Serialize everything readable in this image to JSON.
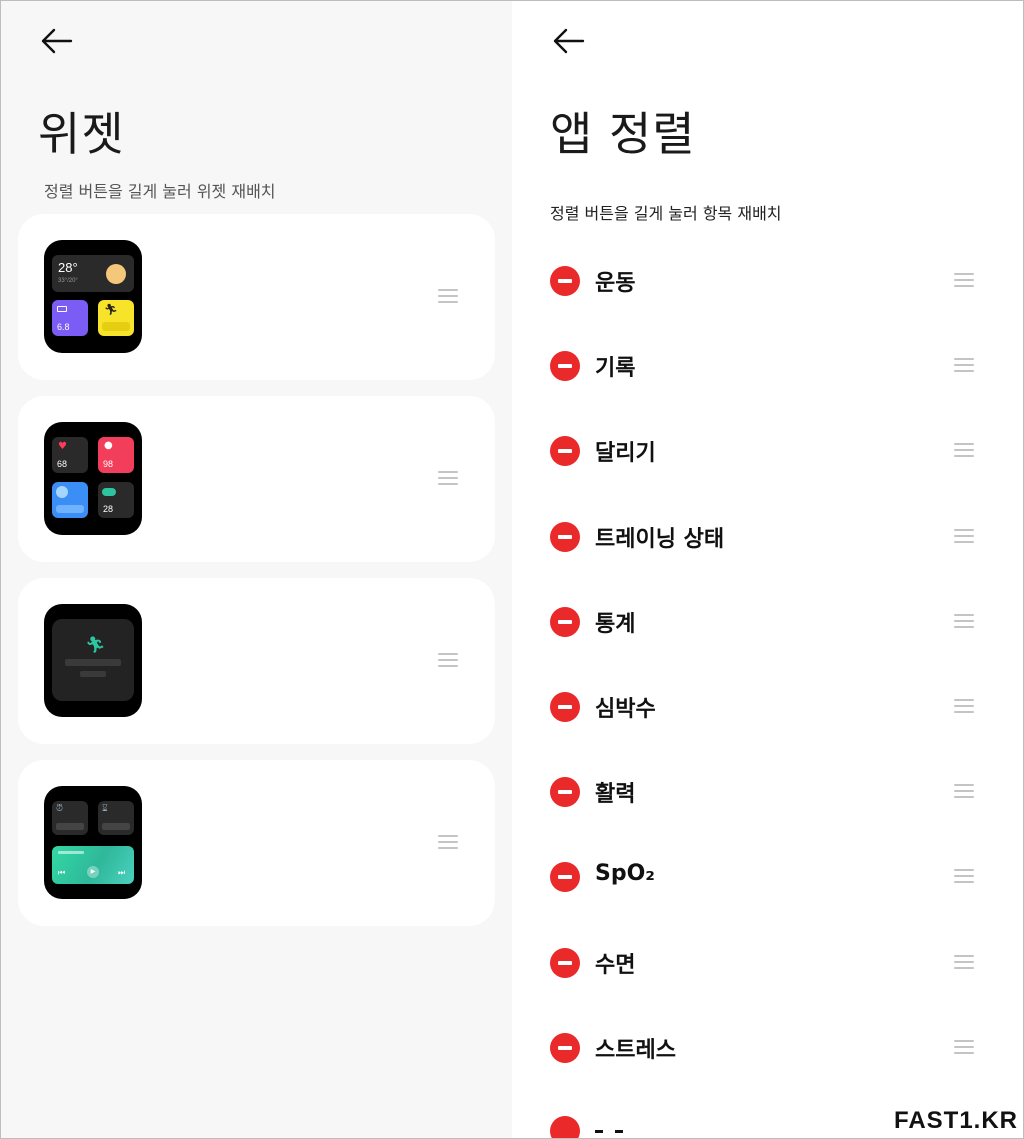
{
  "left_panel": {
    "title": "위젯",
    "hint": "정렬 버튼을 길게 눌러 위젯 재배치",
    "widgets": [
      {
        "temp": "28°",
        "range": "33°/20°",
        "sleep": "6.8"
      },
      {
        "heart": "68",
        "oxygen": "98",
        "other": "28"
      },
      {},
      {}
    ]
  },
  "right_panel": {
    "title": "앱 정렬",
    "hint": "정렬 버튼을 길게 눌러 항목 재배치",
    "apps": [
      "운동",
      "기록",
      "달리기",
      "트레이닝 상태",
      "통계",
      "심박수",
      "활력",
      "SpO₂",
      "수면",
      "스트레스"
    ]
  },
  "watermark": "FAST1.KR",
  "colors": {
    "remove": "#ea2a2a",
    "left_bg": "#f7f7f7",
    "card_bg": "#ffffff"
  },
  "icons": {
    "back": "arrow-left-icon",
    "remove": "minus-circle-icon",
    "drag": "drag-handle-icon"
  }
}
